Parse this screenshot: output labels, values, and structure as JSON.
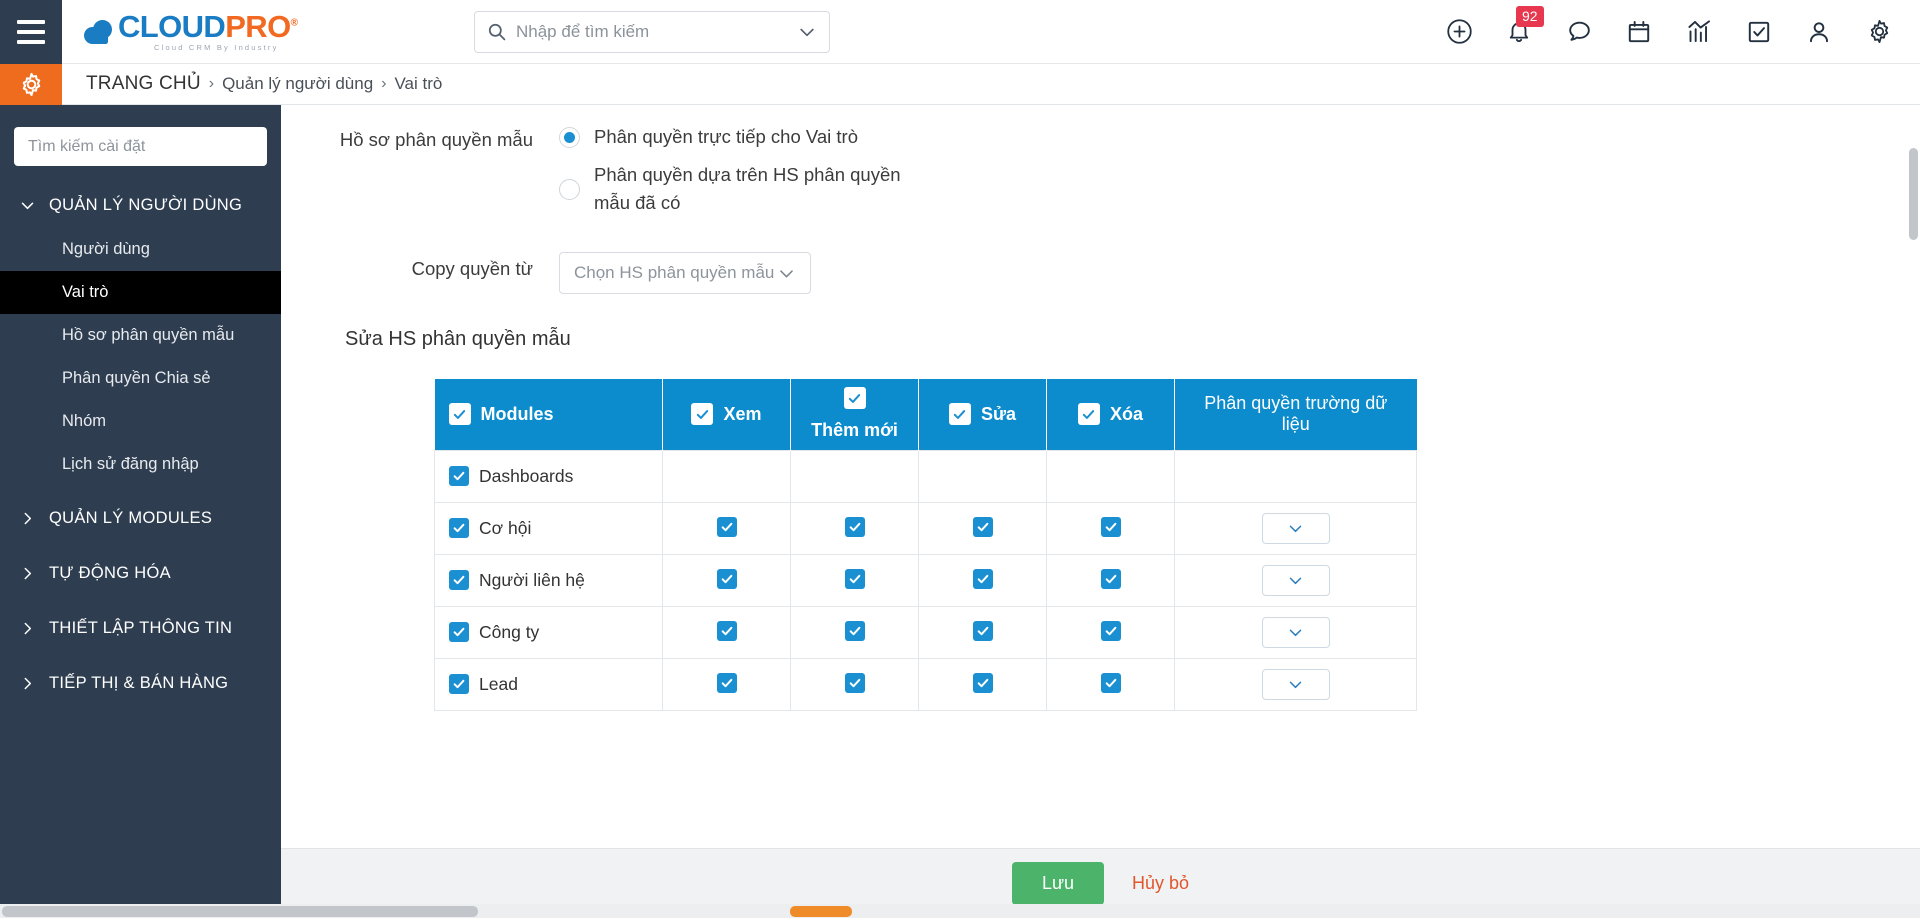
{
  "colors": {
    "brand_blue": "#1a7dc4",
    "brand_orange": "#f26a21",
    "sidebar_bg": "#2e3e50",
    "table_header": "#0c8ccd",
    "checkbox_blue": "#1a8fd1",
    "save_green": "#4cb36b",
    "cancel_red": "#e2562c",
    "badge_red": "#e8384f"
  },
  "header": {
    "menu_icon": "hamburger-icon",
    "logo": {
      "part1": "CLOUD",
      "part2": "PRO",
      "registered": "®",
      "tagline": "Cloud CRM By Industry"
    },
    "search": {
      "placeholder": "Nhập để tìm kiếm",
      "value": "",
      "icon": "search-icon",
      "dropdown_icon": "chevron-down-icon"
    },
    "icons": [
      {
        "name": "add-circle-icon",
        "label": "Thêm mới"
      },
      {
        "name": "bell-icon",
        "label": "Thông báo",
        "badge": "92"
      },
      {
        "name": "chat-icon",
        "label": "Tin nhắn"
      },
      {
        "name": "calendar-icon",
        "label": "Lịch"
      },
      {
        "name": "analytics-icon",
        "label": "Báo cáo"
      },
      {
        "name": "task-check-icon",
        "label": "Công việc"
      },
      {
        "name": "user-icon",
        "label": "Tài khoản"
      },
      {
        "name": "gear-icon",
        "label": "Cài đặt"
      }
    ]
  },
  "breadcrumb": {
    "gear_icon": "settings-gear-icon",
    "home": "TRANG CHỦ",
    "separator": "›",
    "items": [
      {
        "label": "Quản lý người dùng"
      },
      {
        "label": "Vai trò"
      }
    ]
  },
  "sidebar": {
    "search": {
      "placeholder": "Tìm kiếm cài đặt",
      "value": ""
    },
    "groups": [
      {
        "label": "QUẢN LÝ NGƯỜI DÙNG",
        "expanded": true,
        "chevron": "chevron-down-icon",
        "items": [
          {
            "label": "Người dùng",
            "active": false
          },
          {
            "label": "Vai trò",
            "active": true
          },
          {
            "label": "Hồ sơ phân quyền mẫu",
            "active": false
          },
          {
            "label": "Phân quyền Chia sẻ",
            "active": false
          },
          {
            "label": "Nhóm",
            "active": false
          },
          {
            "label": "Lịch sử đăng nhập",
            "active": false
          }
        ]
      },
      {
        "label": "QUẢN LÝ MODULES",
        "expanded": false,
        "chevron": "chevron-right-icon",
        "items": []
      },
      {
        "label": "TỰ ĐỘNG HÓA",
        "expanded": false,
        "chevron": "chevron-right-icon",
        "items": []
      },
      {
        "label": "THIẾT LẬP THÔNG TIN",
        "expanded": false,
        "chevron": "chevron-right-icon",
        "items": []
      },
      {
        "label": "TIẾP THỊ & BÁN HÀNG",
        "expanded": false,
        "chevron": "chevron-right-icon",
        "items": []
      }
    ]
  },
  "main": {
    "profile_row": {
      "label": "Hồ sơ phân quyền mẫu",
      "options": [
        {
          "label": "Phân quyền trực tiếp cho Vai trò",
          "selected": true
        },
        {
          "label": "Phân quyền dựa trên HS phân quyền mẫu đã có",
          "selected": false
        }
      ]
    },
    "copy_row": {
      "label": "Copy quyền từ",
      "select": {
        "placeholder": "Chọn HS phân quyền mẫu",
        "value": "",
        "chevron": "chevron-down-icon"
      }
    },
    "section_title": "Sửa HS phân quyền mẫu",
    "table": {
      "columns": [
        {
          "label": "Modules",
          "checkbox": true,
          "align": "left"
        },
        {
          "label": "Xem",
          "checkbox": true,
          "align": "center"
        },
        {
          "label": "Thêm mới",
          "checkbox": true,
          "align": "center"
        },
        {
          "label": "Sửa",
          "checkbox": true,
          "align": "center"
        },
        {
          "label": "Xóa",
          "checkbox": true,
          "align": "center"
        },
        {
          "label": "Phân quyền trường dữ liệu",
          "checkbox": false,
          "align": "center"
        }
      ],
      "rows": [
        {
          "module": "Dashboards",
          "checked": true,
          "xem": null,
          "them_moi": null,
          "sua": null,
          "xoa": null,
          "field_perm": false
        },
        {
          "module": "Cơ hội",
          "checked": true,
          "xem": true,
          "them_moi": true,
          "sua": true,
          "xoa": true,
          "field_perm": true
        },
        {
          "module": "Người liên hệ",
          "checked": true,
          "xem": true,
          "them_moi": true,
          "sua": true,
          "xoa": true,
          "field_perm": true
        },
        {
          "module": "Công ty",
          "checked": true,
          "xem": true,
          "them_moi": true,
          "sua": true,
          "xoa": true,
          "field_perm": true
        },
        {
          "module": "Lead",
          "checked": true,
          "xem": true,
          "them_moi": true,
          "sua": true,
          "xoa": true,
          "field_perm": true
        }
      ]
    }
  },
  "footer": {
    "save_label": "Lưu",
    "cancel_label": "Hủy bỏ"
  }
}
